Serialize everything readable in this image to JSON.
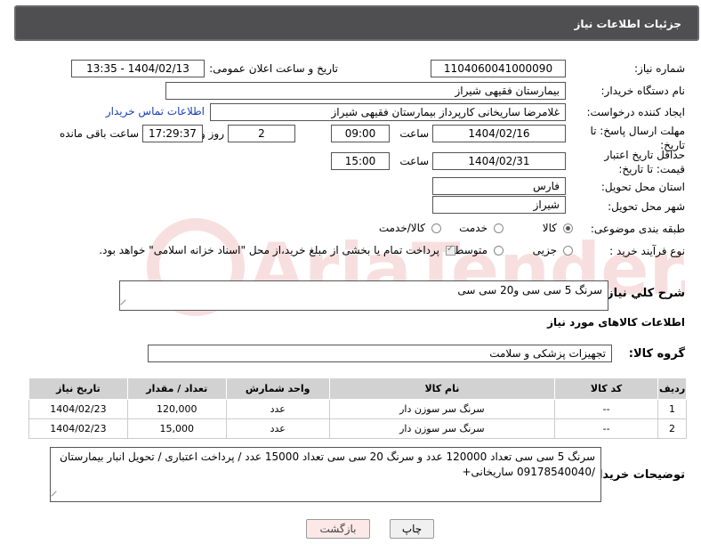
{
  "header": {
    "title": "جزئیات اطلاعات نیاز"
  },
  "fields": {
    "need_number_label": "شماره نیاز:",
    "need_number": "1104060041000090",
    "announce_label": "تاریخ و ساعت اعلان عمومی:",
    "announce_value": "1404/02/13 - 13:35",
    "buyer_org_label": "نام دستگاه خریدار:",
    "buyer_org": "بیمارستان فقیهی شیراز",
    "creator_label": "ایجاد کننده درخواست:",
    "creator": "غلامرضا ساریخانی کارپرداز بیمارستان فقیهی شیراز",
    "contact_link": "اطلاعات تماس خریدار",
    "deadline_label": "مهلت ارسال پاسخ: تا تاریخ:",
    "deadline_date": "1404/02/16",
    "time_word": "ساعت",
    "deadline_time": "09:00",
    "days_value": "2",
    "days_word": "روز و",
    "remaining_time": "17:29:37",
    "remaining_word": "ساعت باقی مانده",
    "min_price_label": "حداقل تاریخ اعتبار قیمت: تا تاریخ:",
    "min_price_date": "1404/02/31",
    "min_price_time": "15:00",
    "province_label": "استان محل تحویل:",
    "province": "فارس",
    "city_label": "شهر محل تحویل:",
    "city": "شیراز",
    "category_label": "طبقه بندی موضوعی:",
    "category_options": [
      "کالا",
      "خدمت",
      "کالا/خدمت"
    ],
    "process_label": "نوع فرآیند خرید :",
    "process_options": [
      "جزیی",
      "متوسط"
    ],
    "payment_note": "پرداخت تمام یا بخشی از مبلغ خرید،از محل \"اسناد خزانه اسلامی\" خواهد بود.",
    "summary_label": "شرح کلي نیاز:",
    "summary": "سرنگ 5 سی سی و20 سی سی",
    "goods_info_title": "اطلاعات کالاهای مورد نیاز",
    "goods_group_label": "گروه کالا:",
    "goods_group": "تجهیزات پزشکی و سلامت",
    "buyer_notes_label": "توضیحات خریدار:",
    "buyer_notes": "سرنگ 5 سی سی تعداد 120000 عدد و سرنگ 20 سی سی تعداد 15000 عدد / پرداخت اعتباری / تحویل انبار بیمارستان /09178540040 ساریخانی+"
  },
  "table": {
    "headers": [
      "ردیف",
      "کد کالا",
      "نام کالا",
      "واحد شمارش",
      "تعداد / مقدار",
      "تاریخ نیاز"
    ],
    "rows": [
      [
        "1",
        "--",
        "سرنگ سر سوزن دار",
        "عدد",
        "120,000",
        "1404/02/23"
      ],
      [
        "2",
        "--",
        "سرنگ سر سوزن دار",
        "عدد",
        "15,000",
        "1404/02/23"
      ]
    ]
  },
  "buttons": {
    "print": "چاپ",
    "back": "بازگشت"
  },
  "watermark": {
    "text": "AriaTender.net"
  }
}
